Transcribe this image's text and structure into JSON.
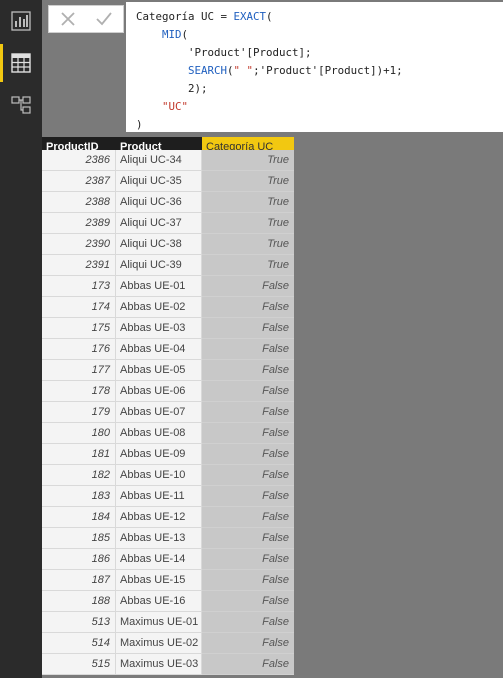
{
  "sidebar": {
    "items": [
      {
        "name": "report-view",
        "icon": "bar-chart-icon"
      },
      {
        "name": "data-view",
        "icon": "table-icon",
        "active": true
      },
      {
        "name": "relationships-view",
        "icon": "relationships-icon"
      }
    ]
  },
  "formula_bar": {
    "lines": [
      "Categoría UC = EXACT(",
      "    MID(",
      "        'Product'[Product];",
      "        SEARCH(\" \";'Product'[Product])+1;",
      "        2);",
      "    \"UC\"",
      ")"
    ]
  },
  "table": {
    "columns": [
      "ProductID",
      "Product",
      "Categoría UC"
    ],
    "rows": [
      [
        "2386",
        "Aliqui UC-34",
        "True"
      ],
      [
        "2387",
        "Aliqui UC-35",
        "True"
      ],
      [
        "2388",
        "Aliqui UC-36",
        "True"
      ],
      [
        "2389",
        "Aliqui UC-37",
        "True"
      ],
      [
        "2390",
        "Aliqui UC-38",
        "True"
      ],
      [
        "2391",
        "Aliqui UC-39",
        "True"
      ],
      [
        "173",
        "Abbas UE-01",
        "False"
      ],
      [
        "174",
        "Abbas UE-02",
        "False"
      ],
      [
        "175",
        "Abbas UE-03",
        "False"
      ],
      [
        "176",
        "Abbas UE-04",
        "False"
      ],
      [
        "177",
        "Abbas UE-05",
        "False"
      ],
      [
        "178",
        "Abbas UE-06",
        "False"
      ],
      [
        "179",
        "Abbas UE-07",
        "False"
      ],
      [
        "180",
        "Abbas UE-08",
        "False"
      ],
      [
        "181",
        "Abbas UE-09",
        "False"
      ],
      [
        "182",
        "Abbas UE-10",
        "False"
      ],
      [
        "183",
        "Abbas UE-11",
        "False"
      ],
      [
        "184",
        "Abbas UE-12",
        "False"
      ],
      [
        "185",
        "Abbas UE-13",
        "False"
      ],
      [
        "186",
        "Abbas UE-14",
        "False"
      ],
      [
        "187",
        "Abbas UE-15",
        "False"
      ],
      [
        "188",
        "Abbas UE-16",
        "False"
      ],
      [
        "513",
        "Maximus UE-01",
        "False"
      ],
      [
        "514",
        "Maximus UE-02",
        "False"
      ],
      [
        "515",
        "Maximus UE-03",
        "False"
      ]
    ]
  },
  "colors": {
    "accent": "#f2c811",
    "sidebar_bg": "#2b2b2b",
    "header_bg": "#1e1e1e",
    "workspace_bg": "#7a7a7a"
  }
}
